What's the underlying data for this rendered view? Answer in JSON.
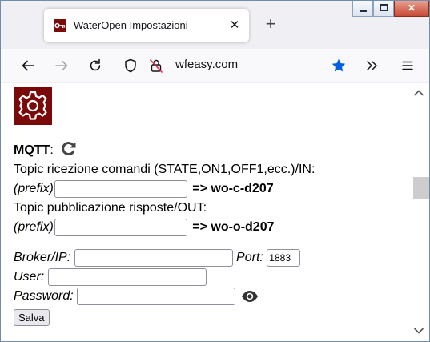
{
  "browser": {
    "tab_title": "WaterOpen Impostazioni",
    "tab_close_glyph": "✕",
    "new_tab_glyph": "+",
    "url": "wfeasy.com",
    "icons": [
      "back-arrow-icon",
      "forward-arrow-icon",
      "reload-icon",
      "shield-icon",
      "lock-off-icon",
      "star-icon",
      "chevrons-right-icon",
      "menu-icon"
    ],
    "star_color": "#0061e0"
  },
  "window_controls": {
    "minimize": "—",
    "maximize": "□",
    "close": "✕"
  },
  "page": {
    "mqtt_label": "MQTT",
    "mqtt_colon": ":",
    "in_topic_label": "Topic ricezione comandi (STATE,ON1,OFF1,ecc.)/IN:",
    "prefix_label": "(prefix)",
    "in_arrow": "=>",
    "in_topic_value": "wo-c-d207",
    "out_topic_label": "Topic pubblicazione risposte/OUT:",
    "out_arrow": "=>",
    "out_topic_value": "wo-o-d207",
    "broker_label": "Broker/IP:",
    "port_label": "Port:",
    "port_value": "1883",
    "user_label": "User:",
    "password_label": "Password:",
    "save_label": "Salva",
    "brand_color": "#7a0a0a"
  }
}
